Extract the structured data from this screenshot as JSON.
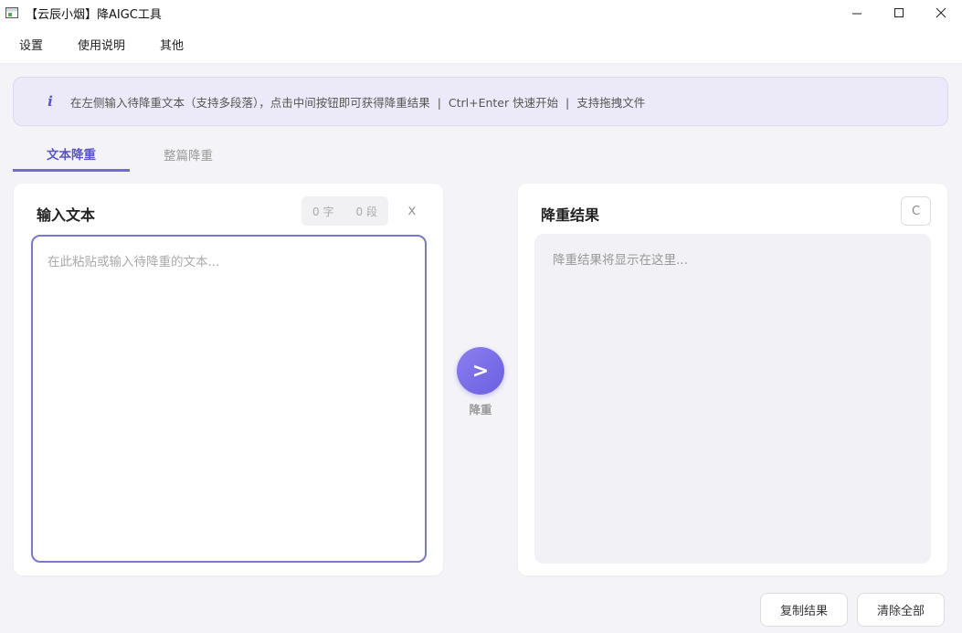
{
  "window": {
    "title": "【云辰小烟】降AIGC工具",
    "minimize_glyph": "minimize-icon",
    "maximize_glyph": "maximize-icon",
    "close_glyph": "close-icon"
  },
  "menu": {
    "items": [
      {
        "label": "设置"
      },
      {
        "label": "使用说明"
      },
      {
        "label": "其他"
      }
    ]
  },
  "banner": {
    "icon": "i",
    "text": "在左侧输入待降重文本（支持多段落），点击中间按钮即可获得降重结果  |  Ctrl+Enter 快速开始  |  支持拖拽文件"
  },
  "tabs": [
    {
      "label": "文本降重",
      "active": true
    },
    {
      "label": "整篇降重",
      "active": false
    }
  ],
  "input_panel": {
    "title": "输入文本",
    "char_count": "0 字",
    "para_count": "0 段",
    "clear_label": "x",
    "placeholder": "在此粘贴或输入待降重的文本..."
  },
  "action": {
    "icon_text": ">",
    "label": "降重"
  },
  "result_panel": {
    "title": "降重结果",
    "copy_icon_label": "C",
    "placeholder": "降重结果将显示在这里..."
  },
  "footer": {
    "copy_button": "复制结果",
    "clear_button": "清除全部"
  },
  "colors": {
    "accent": "#6f6ad4",
    "banner_bg": "#eceaf8",
    "background": "#f4f4f8"
  }
}
